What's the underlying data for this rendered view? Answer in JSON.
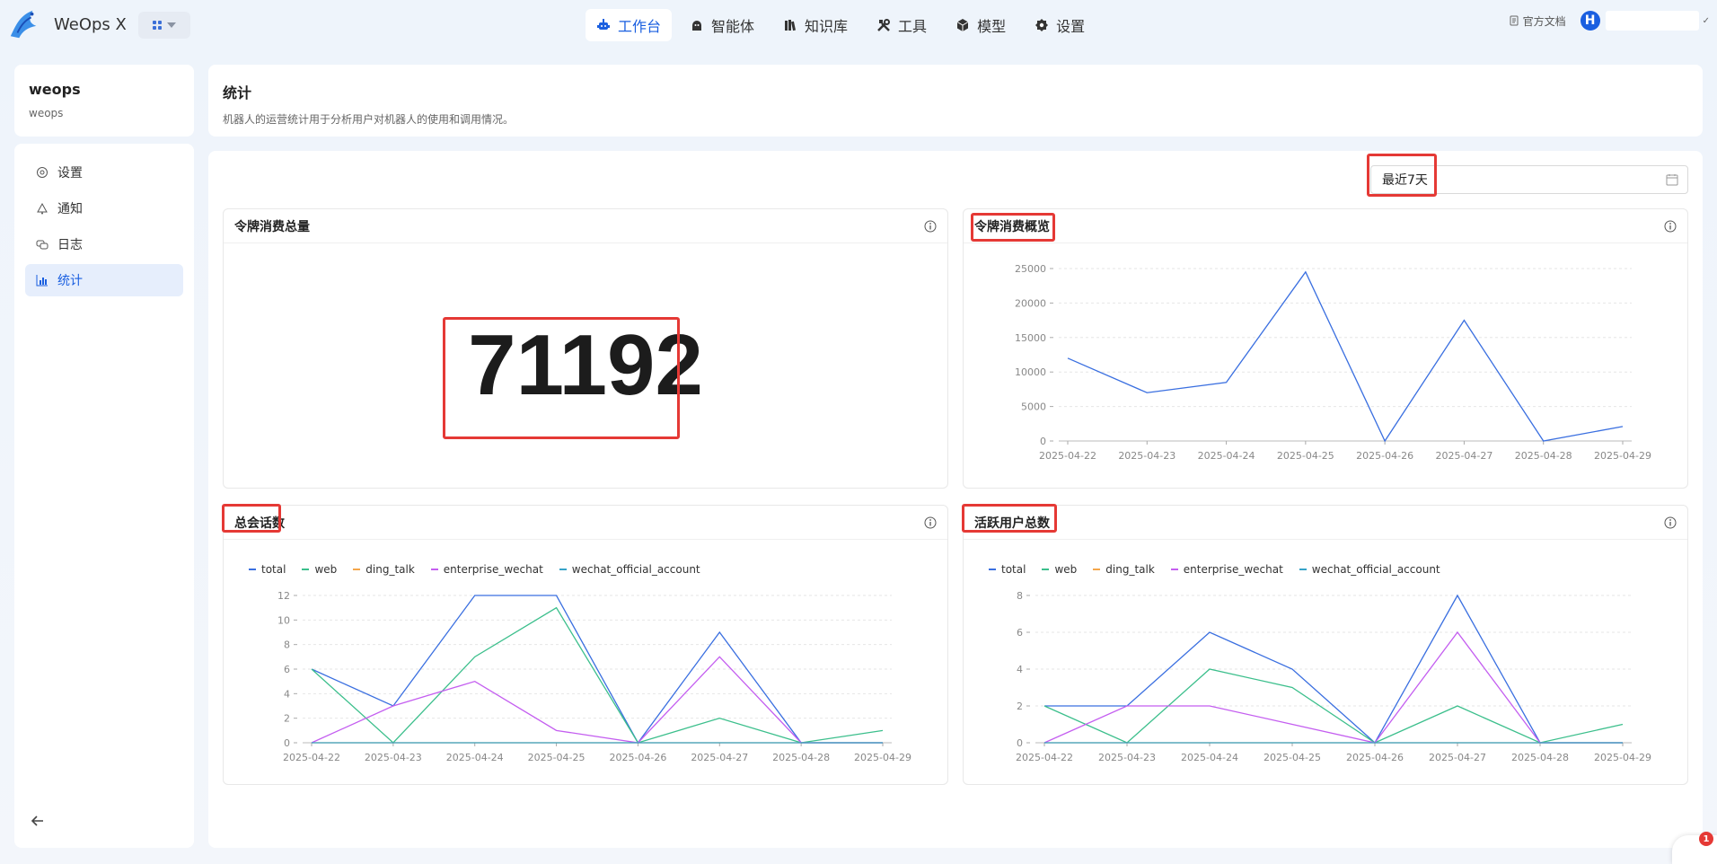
{
  "brand": {
    "name": "WeOps X"
  },
  "nav": {
    "items": [
      {
        "label": "工作台",
        "icon": "robot-icon",
        "active": true
      },
      {
        "label": "智能体",
        "icon": "agent-icon",
        "active": false
      },
      {
        "label": "知识库",
        "icon": "books-icon",
        "active": false
      },
      {
        "label": "工具",
        "icon": "tools-icon",
        "active": false
      },
      {
        "label": "模型",
        "icon": "cube-icon",
        "active": false
      },
      {
        "label": "设置",
        "icon": "gear-icon",
        "active": false
      }
    ],
    "doc_link": "官方文档",
    "avatar_letter": "H"
  },
  "sidebar": {
    "title": "weops",
    "subtitle": "weops",
    "items": [
      {
        "label": "设置",
        "icon": "settings-icon",
        "active": false
      },
      {
        "label": "通知",
        "icon": "bell-icon",
        "active": false
      },
      {
        "label": "日志",
        "icon": "log-icon",
        "active": false
      },
      {
        "label": "统计",
        "icon": "chart-icon",
        "active": true
      }
    ]
  },
  "page": {
    "title": "统计",
    "description": "机器人的运营统计用于分析用户对机器人的使用和调用情况。"
  },
  "filter": {
    "date_range": "最近7天"
  },
  "panels": {
    "token_total": {
      "title": "令牌消费总量",
      "value": "71192"
    },
    "token_overview": {
      "title": "令牌消费概览"
    },
    "sessions": {
      "title": "总会话数"
    },
    "active_users": {
      "title": "活跃用户总数"
    }
  },
  "colors": {
    "total": "#3a6fe0",
    "web": "#3cbf8c",
    "ding_talk": "#f4a64a",
    "enterprise_wechat": "#c45ef0",
    "wechat_official_account": "#36a3c8",
    "accent": "#1a5fe0",
    "highlight": "#e53935"
  },
  "chart_data": [
    {
      "type": "line",
      "x": [
        "2025-04-22",
        "2025-04-23",
        "2025-04-24",
        "2025-04-25",
        "2025-04-26",
        "2025-04-27",
        "2025-04-28",
        "2025-04-29"
      ],
      "series": [
        {
          "values": [
            12000,
            7000,
            8500,
            24500,
            0,
            17500,
            0,
            2100
          ]
        }
      ],
      "yticks": [
        0,
        5000,
        10000,
        15000,
        20000,
        25000
      ],
      "ylim": [
        0,
        25000
      ],
      "grid": true
    },
    {
      "type": "line",
      "x": [
        "2025-04-22",
        "2025-04-23",
        "2025-04-24",
        "2025-04-25",
        "2025-04-26",
        "2025-04-27",
        "2025-04-28",
        "2025-04-29"
      ],
      "series": [
        {
          "name": "total",
          "values": [
            6,
            3,
            12,
            12,
            0,
            9,
            0,
            0
          ]
        },
        {
          "name": "web",
          "values": [
            6,
            0,
            7,
            11,
            0,
            2,
            0,
            1
          ]
        },
        {
          "name": "ding_talk",
          "values": [
            0,
            0,
            0,
            0,
            0,
            0,
            0,
            0
          ]
        },
        {
          "name": "enterprise_wechat",
          "values": [
            0,
            3,
            5,
            1,
            0,
            7,
            0,
            0
          ]
        },
        {
          "name": "wechat_official_account",
          "values": [
            0,
            0,
            0,
            0,
            0,
            0,
            0,
            0
          ]
        }
      ],
      "yticks": [
        0,
        2,
        4,
        6,
        8,
        10,
        12
      ],
      "ylim": [
        0,
        12
      ],
      "legend": "top-left",
      "grid": true
    },
    {
      "type": "line",
      "x": [
        "2025-04-22",
        "2025-04-23",
        "2025-04-24",
        "2025-04-25",
        "2025-04-26",
        "2025-04-27",
        "2025-04-28",
        "2025-04-29"
      ],
      "series": [
        {
          "name": "total",
          "values": [
            2,
            2,
            6,
            4,
            0,
            8,
            0,
            0
          ]
        },
        {
          "name": "web",
          "values": [
            2,
            0,
            4,
            3,
            0,
            2,
            0,
            1
          ]
        },
        {
          "name": "ding_talk",
          "values": [
            0,
            0,
            0,
            0,
            0,
            0,
            0,
            0
          ]
        },
        {
          "name": "enterprise_wechat",
          "values": [
            0,
            2,
            2,
            1,
            0,
            6,
            0,
            0
          ]
        },
        {
          "name": "wechat_official_account",
          "values": [
            0,
            0,
            0,
            0,
            0,
            0,
            0,
            0
          ]
        }
      ],
      "yticks": [
        0,
        2,
        4,
        6,
        8
      ],
      "ylim": [
        0,
        8
      ],
      "legend": "top-left",
      "grid": true
    }
  ]
}
